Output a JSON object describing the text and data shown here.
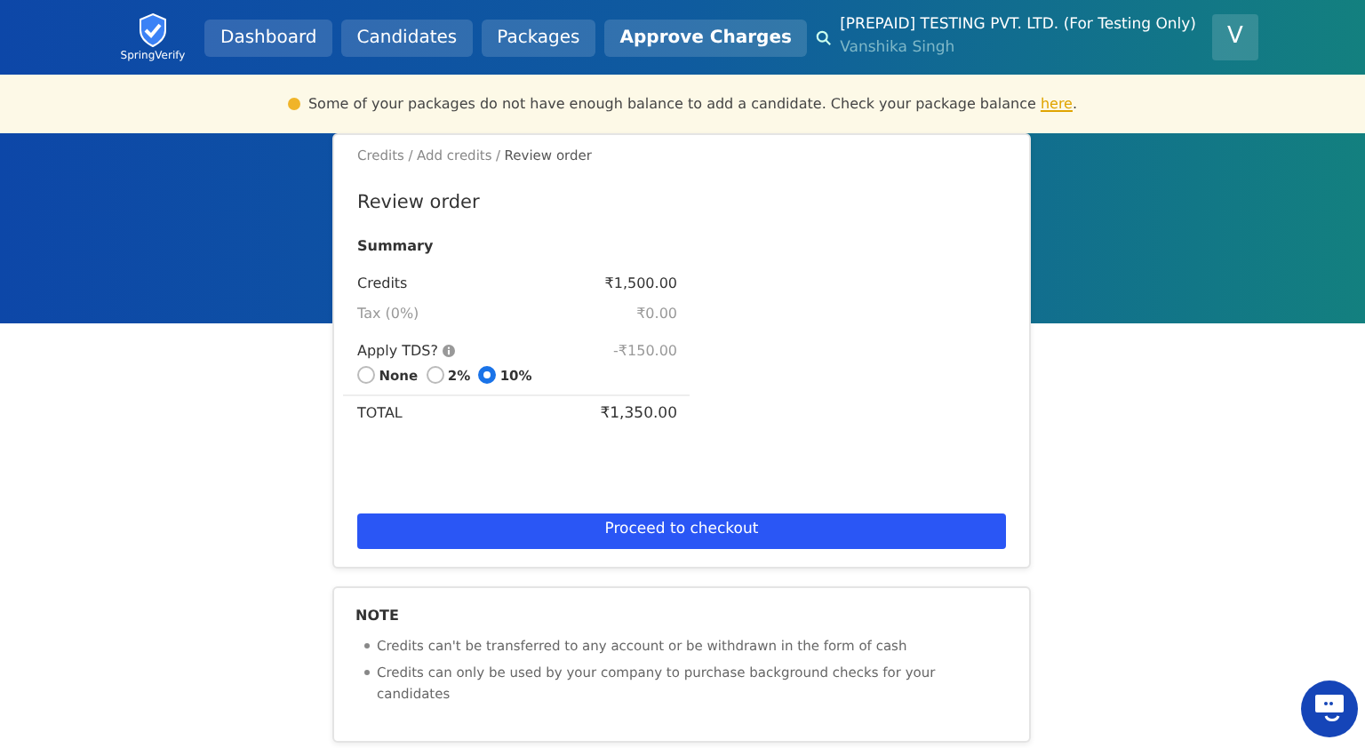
{
  "logo": {
    "text": "SpringVerify"
  },
  "nav": [
    {
      "label": "Dashboard",
      "selected": false
    },
    {
      "label": "Candidates",
      "selected": false
    },
    {
      "label": "Packages",
      "selected": false
    },
    {
      "label": "Approve Charges",
      "selected": true
    }
  ],
  "account": {
    "company": "[PREPAID] TESTING PVT. LTD. (For Testing Only)",
    "user": "Vanshika Singh",
    "avatar": "V"
  },
  "alert": {
    "text": "Some of your packages do not have enough balance to add a candidate. Check your package balance ",
    "link": "here",
    "end": "."
  },
  "breadcrumb_separator": "/",
  "breadcrumb": [
    {
      "label": "Credits",
      "current": false
    },
    {
      "label": "Add credits",
      "current": false
    },
    {
      "label": "Review order",
      "current": true
    }
  ],
  "title": "Review order",
  "summary_heading": "Summary",
  "lines": [
    {
      "label": "Credits",
      "value": "₹1,500.00",
      "muted": false
    },
    {
      "label": "Tax (0%)",
      "value": "₹0.00",
      "muted": true
    }
  ],
  "tds": {
    "label": "Apply TDS?",
    "value": "-₹150.00",
    "options": [
      {
        "label": "None",
        "selected": false
      },
      {
        "label": "2%",
        "selected": false
      },
      {
        "label": "10%",
        "selected": true
      }
    ]
  },
  "total": {
    "label": "TOTAL",
    "value": "₹1,350.00"
  },
  "checkout_button": "Proceed to checkout",
  "note": {
    "heading": "NOTE",
    "items": [
      "Credits can't be transferred to any account or be withdrawn in the form of cash",
      "Credits can only be used by your company to purchase background checks for your candidates"
    ]
  }
}
